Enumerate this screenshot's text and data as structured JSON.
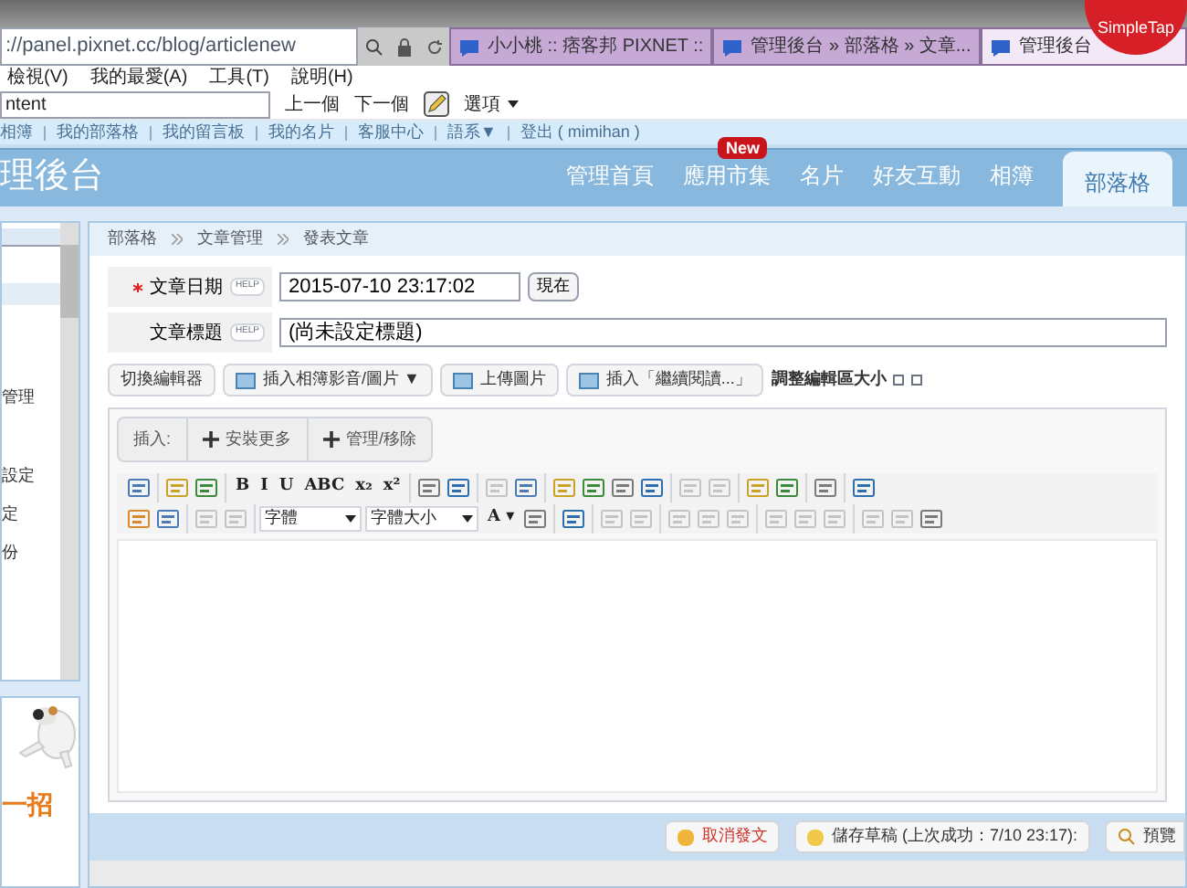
{
  "browser": {
    "address": "://panel.pixnet.cc/blog/articlenew",
    "tabs": [
      {
        "title": "小小桃 :: 痞客邦 PIXNET ::",
        "selected": false
      },
      {
        "title": "管理後台 » 部落格 » 文章...",
        "selected": false
      },
      {
        "title": "管理後台",
        "selected": true
      }
    ],
    "badge": "SimpleTap",
    "menu": [
      "檢視(V)",
      "我的最愛(A)",
      "工具(T)",
      "說明(H)"
    ],
    "find": {
      "value": "ntent",
      "prev": "上一個",
      "next": "下一個",
      "options": "選項"
    }
  },
  "links": [
    "相簿",
    "我的部落格",
    "我的留言板",
    "我的名片",
    "客服中心",
    "語系▼",
    "登出 ( mimihan )"
  ],
  "header": {
    "title": "理後台",
    "nav": [
      {
        "label": "管理首頁",
        "selected": false
      },
      {
        "label": "應用市集",
        "selected": false,
        "badge": "New"
      },
      {
        "label": "名片",
        "selected": false
      },
      {
        "label": "好友互動",
        "selected": false
      },
      {
        "label": "相簿",
        "selected": false
      },
      {
        "label": "部落格",
        "selected": true
      }
    ]
  },
  "sidebar": {
    "items": [
      "管理",
      "設定",
      "定",
      "份"
    ],
    "promo": "一招"
  },
  "breadcrumb": [
    "部落格",
    "文章管理",
    "發表文章"
  ],
  "form": [
    {
      "label": "文章日期",
      "required": true,
      "help": "HELP",
      "value": "2015-07-10 23:17:02",
      "button": "現在"
    },
    {
      "label": "文章標題",
      "required": false,
      "help": "HELP",
      "value": "(尚未設定標題)"
    }
  ],
  "toolbar": [
    {
      "label": "切換編輯器",
      "icon": false
    },
    {
      "label": "插入相簿影音/圖片 ▼",
      "icon": true
    },
    {
      "label": "上傳圖片",
      "icon": true
    },
    {
      "label": "插入「繼續閱讀...」",
      "icon": true
    }
  ],
  "resize": "調整編輯區大小",
  "insert": {
    "label": "插入:",
    "buttons": [
      "安裝更多",
      "管理/移除"
    ]
  },
  "editor_rows": [
    [
      {
        "kind": "icon",
        "disabled": false
      },
      {
        "kind": "sep"
      },
      {
        "kind": "icon",
        "disabled": false
      },
      {
        "kind": "icon",
        "disabled": false
      },
      {
        "kind": "sep"
      },
      {
        "kind": "text",
        "label": "B"
      },
      {
        "kind": "text",
        "label": "I"
      },
      {
        "kind": "text",
        "label": "U"
      },
      {
        "kind": "text",
        "label": "ABC"
      },
      {
        "kind": "text",
        "label": "x₂"
      },
      {
        "kind": "text",
        "label": "x²"
      },
      {
        "kind": "sep"
      },
      {
        "kind": "icon",
        "disabled": false
      },
      {
        "kind": "icon",
        "disabled": false
      },
      {
        "kind": "sep"
      },
      {
        "kind": "icon",
        "disabled": true
      },
      {
        "kind": "icon",
        "disabled": false
      },
      {
        "kind": "sep"
      },
      {
        "kind": "icon",
        "disabled": false
      },
      {
        "kind": "icon",
        "disabled": false
      },
      {
        "kind": "icon",
        "disabled": false
      },
      {
        "kind": "icon",
        "disabled": false
      },
      {
        "kind": "sep"
      },
      {
        "kind": "icon",
        "disabled": true
      },
      {
        "kind": "icon",
        "disabled": true
      },
      {
        "kind": "sep"
      },
      {
        "kind": "icon",
        "disabled": false
      },
      {
        "kind": "icon",
        "disabled": false
      },
      {
        "kind": "sep"
      },
      {
        "kind": "icon",
        "disabled": false
      },
      {
        "kind": "sep"
      },
      {
        "kind": "icon",
        "disabled": false
      }
    ],
    [
      {
        "kind": "icon",
        "disabled": false
      },
      {
        "kind": "icon",
        "disabled": false
      },
      {
        "kind": "sep"
      },
      {
        "kind": "icon",
        "disabled": true
      },
      {
        "kind": "icon",
        "disabled": true
      },
      {
        "kind": "sep"
      },
      {
        "kind": "select",
        "label": "字體"
      },
      {
        "kind": "select",
        "label": "字體大小"
      },
      {
        "kind": "text",
        "label": "A ▾"
      },
      {
        "kind": "icon",
        "disabled": false
      },
      {
        "kind": "sep"
      },
      {
        "kind": "icon",
        "disabled": false
      },
      {
        "kind": "sep"
      },
      {
        "kind": "icon",
        "disabled": true
      },
      {
        "kind": "icon",
        "disabled": true
      },
      {
        "kind": "sep"
      },
      {
        "kind": "icon",
        "disabled": true
      },
      {
        "kind": "icon",
        "disabled": true
      },
      {
        "kind": "icon",
        "disabled": true
      },
      {
        "kind": "sep"
      },
      {
        "kind": "icon",
        "disabled": true
      },
      {
        "kind": "icon",
        "disabled": true
      },
      {
        "kind": "icon",
        "disabled": true
      },
      {
        "kind": "sep"
      },
      {
        "kind": "icon",
        "disabled": true
      },
      {
        "kind": "icon",
        "disabled": true
      },
      {
        "kind": "icon",
        "disabled": false
      }
    ]
  ],
  "footer": {
    "cancel": "取消發文",
    "save": "儲存草稿 (上次成功：7/10 23:17):",
    "preview": "預覽"
  }
}
